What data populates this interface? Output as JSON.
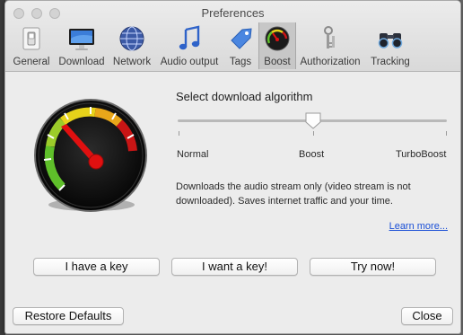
{
  "window": {
    "title": "Preferences"
  },
  "tabs": [
    {
      "id": "general",
      "label": "General",
      "icon": "switch-icon"
    },
    {
      "id": "download",
      "label": "Download",
      "icon": "monitor-icon"
    },
    {
      "id": "network",
      "label": "Network",
      "icon": "globe-icon"
    },
    {
      "id": "audio",
      "label": "Audio output",
      "icon": "music-note-icon"
    },
    {
      "id": "tags",
      "label": "Tags",
      "icon": "tag-icon"
    },
    {
      "id": "boost",
      "label": "Boost",
      "icon": "speedometer-icon",
      "active": true
    },
    {
      "id": "authorization",
      "label": "Authorization",
      "icon": "keys-icon"
    },
    {
      "id": "tracking",
      "label": "Tracking",
      "icon": "binoculars-icon"
    }
  ],
  "boost": {
    "heading": "Select download algorithm",
    "slider": {
      "options": [
        "Normal",
        "Boost",
        "TurboBoost"
      ],
      "selected": "Boost"
    },
    "description": "Downloads the audio stream only (video stream is not downloaded). Saves internet traffic and your time.",
    "learn_more": "Learn more...",
    "buttons": {
      "have_key": "I have a key",
      "want_key": "I want a key!",
      "try_now": "Try now!"
    }
  },
  "footer": {
    "restore": "Restore Defaults",
    "close": "Close"
  },
  "colors": {
    "link": "#1a4fd6",
    "needle": "#e01010",
    "gauge_green": "#5fbf2a",
    "gauge_yellow": "#e6d21a",
    "gauge_red": "#c81515"
  }
}
